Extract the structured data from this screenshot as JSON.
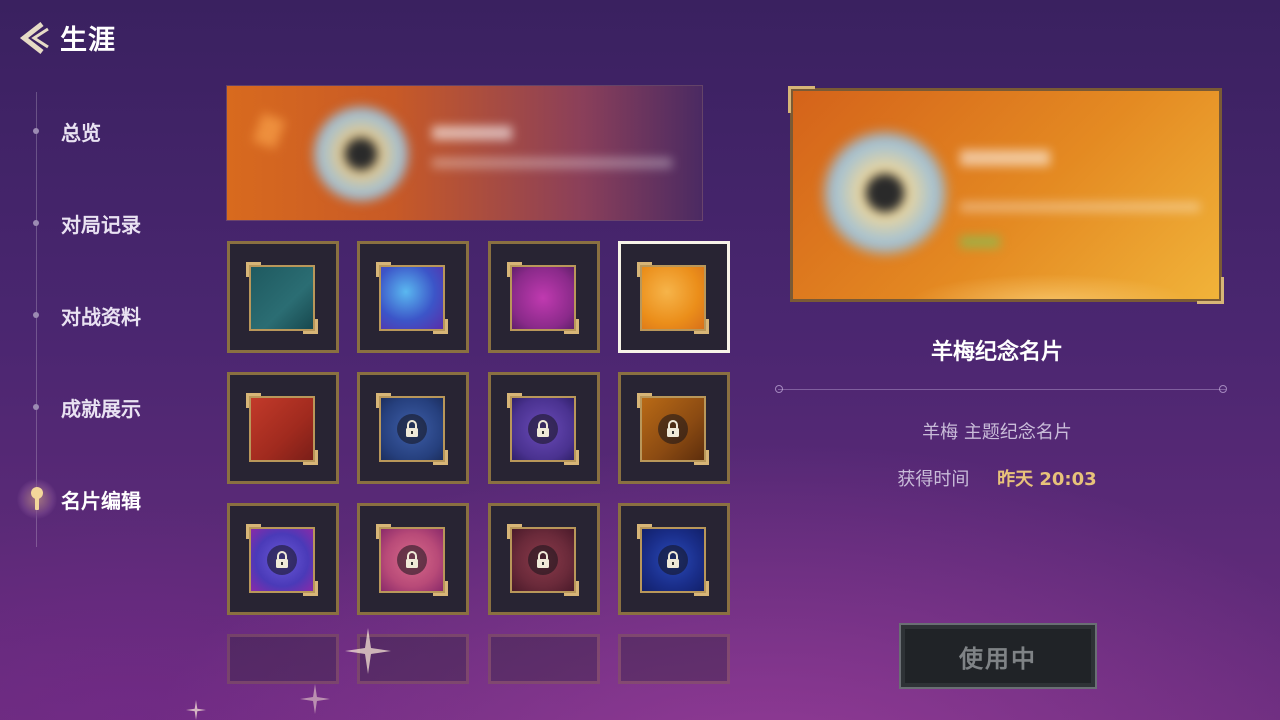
{
  "header": {
    "title": "生涯"
  },
  "sidebar": {
    "items": [
      {
        "label": "总览"
      },
      {
        "label": "对局记录"
      },
      {
        "label": "对战资料"
      },
      {
        "label": "成就展示"
      },
      {
        "label": "名片编辑",
        "active": true
      }
    ]
  },
  "grid": {
    "tiles": [
      {
        "theme": "teal",
        "locked": false
      },
      {
        "theme": "cosmic-blue",
        "locked": false
      },
      {
        "theme": "magenta-music",
        "locked": false
      },
      {
        "theme": "orange-sheep",
        "locked": false,
        "selected": true
      },
      {
        "theme": "red",
        "locked": false
      },
      {
        "theme": "navy",
        "locked": true
      },
      {
        "theme": "violet",
        "locked": true
      },
      {
        "theme": "amber",
        "locked": true
      },
      {
        "theme": "blue-purple",
        "locked": true
      },
      {
        "theme": "pink",
        "locked": true
      },
      {
        "theme": "maroon",
        "locked": true
      },
      {
        "theme": "deep-blue",
        "locked": true
      }
    ]
  },
  "detail": {
    "name": "羊梅纪念名片",
    "description": "羊梅 主题纪念名片",
    "obtained_label": "获得时间",
    "obtained_value": "昨天 20:03",
    "use_button": "使用中"
  },
  "colors": {
    "accent_gold": "#e8c27a",
    "tile_border": "#8a7041",
    "selected_border": "#f7f3e8"
  }
}
